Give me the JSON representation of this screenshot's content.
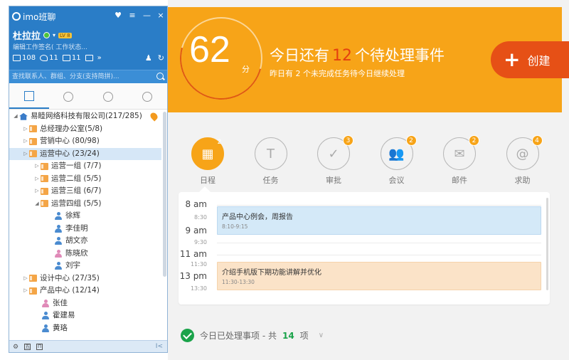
{
  "im": {
    "app_title": "imo班聊",
    "window_buttons": [
      "♥",
      "≡",
      "—",
      "×"
    ],
    "user_name": "杜拉拉",
    "level_badge": "LV 8",
    "signature_placeholder": "编辑工作签名( 工作状态...",
    "stats": [
      {
        "icon": "mail-icon",
        "count": "108"
      },
      {
        "icon": "group-chat-icon",
        "count": "11"
      },
      {
        "icon": "discussion-icon",
        "count": "11"
      }
    ],
    "more_label": "»",
    "search_placeholder": "查找联系人、群组、分支(支持简拼)...",
    "tabs": [
      {
        "name": "tab-organization",
        "icon": "org-tree-icon"
      },
      {
        "name": "tab-contacts",
        "icon": "person-icon"
      },
      {
        "name": "tab-messages",
        "icon": "chat-bubble-icon"
      },
      {
        "name": "tab-recent",
        "icon": "clock-icon"
      }
    ],
    "tree": [
      {
        "label": "易睦网络科技有限公司(217/285)",
        "depth": 0,
        "type": "company",
        "arrow": "◢"
      },
      {
        "label": "总经理办公室(5/8)",
        "depth": 1,
        "type": "folder",
        "arrow": "▷"
      },
      {
        "label": "营销中心 (80/98)",
        "depth": 1,
        "type": "folder",
        "arrow": "▷"
      },
      {
        "label": "运营中心 (23/24)",
        "depth": 1,
        "type": "folder",
        "arrow": "▷",
        "selected": true
      },
      {
        "label": "运营一组 (7/7)",
        "depth": 2,
        "type": "folder",
        "arrow": "▷"
      },
      {
        "label": "运营二组 (5/5)",
        "depth": 2,
        "type": "folder",
        "arrow": "▷"
      },
      {
        "label": "运营三组 (6/7)",
        "depth": 2,
        "type": "folder",
        "arrow": "▷"
      },
      {
        "label": "运营四组 (5/5)",
        "depth": 2,
        "type": "folder",
        "arrow": "◢"
      },
      {
        "label": "徐辉",
        "depth": 3,
        "type": "person",
        "gender": "m"
      },
      {
        "label": "李佳明",
        "depth": 3,
        "type": "person",
        "gender": "m"
      },
      {
        "label": "胡文亦",
        "depth": 3,
        "type": "person",
        "gender": "m"
      },
      {
        "label": "陈晓欣",
        "depth": 3,
        "type": "person",
        "gender": "f"
      },
      {
        "label": "刘宇",
        "depth": 3,
        "type": "person",
        "gender": "m"
      },
      {
        "label": "设计中心 (27/35)",
        "depth": 1,
        "type": "folder",
        "arrow": "▷"
      },
      {
        "label": "产品中心 (12/14)",
        "depth": 1,
        "type": "folder",
        "arrow": "▷"
      },
      {
        "label": "张佳",
        "depth": 2,
        "type": "person",
        "gender": "f"
      },
      {
        "label": "霍建易",
        "depth": 2,
        "type": "person",
        "gender": "m"
      },
      {
        "label": "黄珞",
        "depth": 2,
        "type": "person",
        "gender": "m"
      }
    ],
    "footer_keys": [
      "五",
      "П"
    ],
    "footer_collapse": "I<"
  },
  "dashboard": {
    "score": "62",
    "score_unit": "分",
    "headline_prefix": "今日还有",
    "pending_count": "12",
    "headline_suffix": "个待处理事件",
    "subline": "昨日有 2 个未完成任务待今日继续处理",
    "create_label": "创建",
    "categories": [
      {
        "label": "日程",
        "glyph": "▦",
        "badge": "2",
        "active": true
      },
      {
        "label": "任务",
        "glyph": "T",
        "badge": ""
      },
      {
        "label": "审批",
        "glyph": "✓",
        "badge": "3"
      },
      {
        "label": "会议",
        "glyph": "👥",
        "badge": "2"
      },
      {
        "label": "邮件",
        "glyph": "✉",
        "badge": "2"
      },
      {
        "label": "求助",
        "glyph": "@",
        "badge": "4"
      }
    ],
    "timeline": {
      "hours": [
        {
          "label": "8 am",
          "big": true
        },
        {
          "label": "8:30",
          "big": false
        },
        {
          "label": "9 am",
          "big": true
        },
        {
          "label": "9:30",
          "big": false
        },
        {
          "label": "11 am",
          "big": true
        },
        {
          "label": "11:30",
          "big": false
        },
        {
          "label": "13 pm",
          "big": true
        },
        {
          "label": "13:30",
          "big": false
        }
      ],
      "events": [
        {
          "title": "产品中心例会，周报告",
          "time": "8:10-9:15",
          "color": "blue"
        },
        {
          "title": "介绍手机版下期功能讲解并优化",
          "time": "11:30-13:30",
          "color": "orange"
        }
      ]
    },
    "done_prefix": "今日已处理事项 - 共",
    "done_count": "14",
    "done_suffix": "项"
  }
}
